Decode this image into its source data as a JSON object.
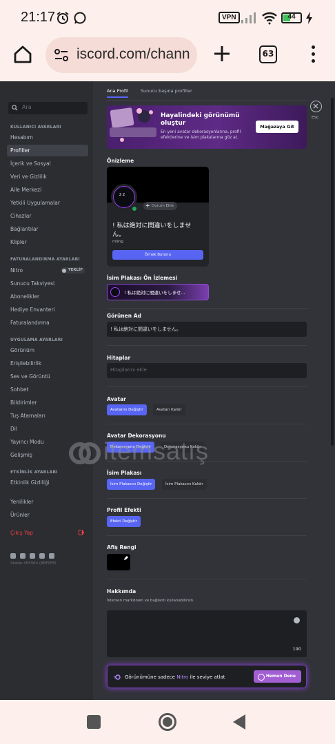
{
  "status_bar": {
    "time": "21:17",
    "vpn": "VPN",
    "battery": "44"
  },
  "browser": {
    "url": "iscord.com/chann",
    "tab_count": "63"
  },
  "sidebar": {
    "search_placeholder": "Ara",
    "sections": {
      "user": "KULLANICI AYARLARI",
      "billing": "FATURALANDIRMA AYARLARI",
      "app": "UYGULAMA AYARLARI",
      "activity": "ETKİNLİK AYARLARI"
    },
    "user_items": [
      "Hesabım",
      "Profiller",
      "İçerik ve Sosyal",
      "Veri ve Gizlilik",
      "Aile Merkezi",
      "Yetkili Uygulamalar",
      "Cihazlar",
      "Bağlantılar",
      "Klipler"
    ],
    "billing_items": [
      "Nitro",
      "Sunucu Takviyesi",
      "Abonelikler",
      "Hediye Envanteri",
      "Faturalandırma"
    ],
    "nitro_badge": "TEKLİF",
    "app_items": [
      "Görünüm",
      "Erişilebilirlik",
      "Ses ve Görüntü",
      "Sohbet",
      "Bildirimler",
      "Tuş Atamaları",
      "Dil",
      "Yayıncı Modu",
      "Gelişmiş"
    ],
    "activity_items": [
      "Etkinlik Gizliliği"
    ],
    "misc_items": [
      "Yenilikler",
      "Ürünler"
    ],
    "logout": "Çıkış Yap",
    "build": "Stable 455964 (8BF0F8)"
  },
  "main": {
    "tabs": [
      "Ana Profil",
      "Sunucu başına profiller"
    ],
    "esc": "ESC",
    "promo": {
      "title": "Hayalindeki görünümü oluştur",
      "desc": "En yeni avatar dekorasyonlarına, profil efektlerine ve isim plakalarına göz at.",
      "button": "Mağazaya Git"
    },
    "preview_label": "Önizleme",
    "status_button": "Durum Ekle",
    "display_name": "! 私は絶対に間違いをしませ ん。",
    "username": "m9ng",
    "example_button": "Örnek Butonu",
    "nameplate_label": "İsim Plakası Ön İzlemesi",
    "nameplate_text": "! 私は絶対に間違いをしませ...",
    "display_name_label": "Görünen Ad",
    "display_name_value": "! 私は絶対に間違いをしません。",
    "pronouns_label": "Hitaplar",
    "pronouns_placeholder": "Hitaplarını ekle",
    "avatar_label": "Avatar",
    "avatar_change": "Avatarını Değiştir",
    "avatar_remove": "Avatarı Kaldır",
    "decoration_label": "Avatar Dekorasyonu",
    "decoration_change": "Dekorasyonu Değiştir",
    "decoration_remove": "Dekorasyonu Kaldır",
    "plate_label": "İsim Plakası",
    "plate_change": "İsim Plakasını Değiştir",
    "plate_remove": "İsim Plakasını Kaldır",
    "effect_label": "Profil Efekti",
    "effect_change": "Efekti Değiştir",
    "banner_label": "Afiş Rengi",
    "about_label": "Hakkımda",
    "about_hint": "İstersen markdown ve bağlantı kullanabilirsin.",
    "about_counter": "190",
    "nitro_prefix": "Görünümüne sadece",
    "nitro_word": "Nitro",
    "nitro_suffix": "ile seviye atlat",
    "nitro_button": "Hemen Dene"
  },
  "watermark": "itemsatış",
  "colors": {
    "accent": "#5865f2",
    "sidebar_bg": "#2b2d31",
    "main_bg": "#313338",
    "danger": "#f23f43",
    "online": "#23a55a",
    "nitro": "#a25fd4"
  }
}
